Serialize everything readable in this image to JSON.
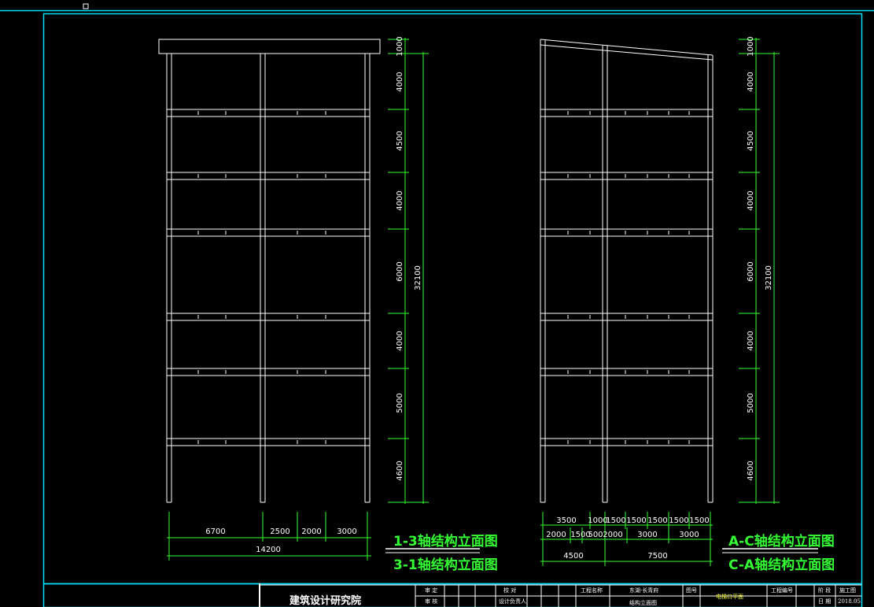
{
  "colors": {
    "background": "#000000",
    "frame": "#00e5ff",
    "structure": "#ffffff",
    "dimension": "#33ff33",
    "title_text": "#33ff33"
  },
  "left_elevation": {
    "title_top": "1-3轴结构立面图",
    "title_bottom": "3-1轴结构立面图",
    "height_dims": [
      "1000",
      "4000",
      "4500",
      "4000",
      "6000",
      "4000",
      "5000",
      "4600"
    ],
    "total_height": "32100",
    "bay_dims": [
      "6700",
      "2500",
      "2000",
      "3000"
    ],
    "total_width": "14200"
  },
  "right_elevation": {
    "title_top": "A-C轴结构立面图",
    "title_bottom": "C-A轴结构立面图",
    "height_dims": [
      "1000",
      "4000",
      "4500",
      "4000",
      "6000",
      "4000",
      "5000",
      "4600"
    ],
    "total_height": "32100",
    "dims_row1": [
      "3500",
      "1000",
      "1500",
      "1500",
      "1500",
      "1500",
      "1500"
    ],
    "dims_row2": [
      "2000",
      "1500",
      "500",
      "2000",
      "3000",
      "3000"
    ],
    "dims_row3": [
      "4500",
      "7500"
    ]
  },
  "title_block": {
    "institute": "建筑设计研究院",
    "cells": [
      "审 定",
      "审 核",
      "校 对",
      "设计负责人",
      "工程名称",
      "东湖·长青府",
      "结构立面图",
      "图号",
      "电梯口平面",
      "工程编号",
      "阶 段",
      "施工图",
      "日 期",
      "2018.05"
    ]
  }
}
